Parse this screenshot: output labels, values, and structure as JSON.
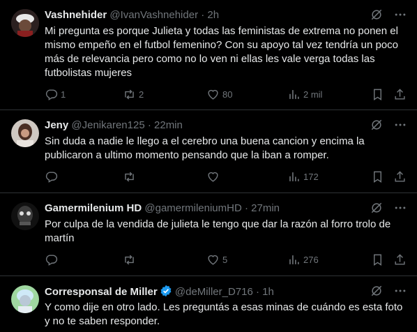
{
  "tweets": [
    {
      "name": "Vashnehider",
      "handle": "@IvanVashnehider",
      "time": "· 2h",
      "text": "Mi pregunta es porque Julieta y todas las feministas de extrema no ponen el mismo empeño en el futbol femenino? Con su apoyo tal vez tendría un poco más de relevancia pero como no lo ven ni ellas les vale verga todas las futbolistas mujeres",
      "replies": "1",
      "retweets": "2",
      "likes": "80",
      "views": "2 mil"
    },
    {
      "name": "Jeny",
      "handle": "@Jenikaren125",
      "time": "· 22min",
      "text": "Sin duda a nadie le llego a el cerebro una buena cancion y encima la publicaron a ultimo momento pensando que la iban a romper.",
      "replies": "",
      "retweets": "",
      "likes": "",
      "views": "172"
    },
    {
      "name": "Gamermilenium HD",
      "handle": "@gamermileniumHD",
      "time": "· 27min",
      "text": "Por culpa de la vendida de julieta le tengo que dar la razón al forro trolo de martín",
      "replies": "",
      "retweets": "",
      "likes": "5",
      "views": "276"
    },
    {
      "name": "Corresponsal de Miller",
      "handle": "@deMiller_D716",
      "time": "· 1h",
      "text": "Y como dije en otro lado. Les preguntás a esas minas de cuándo es esta foto y no te saben responder.",
      "replies": "",
      "retweets": "",
      "likes": "",
      "views": ""
    }
  ],
  "icons": {
    "reply": "reply-icon",
    "retweet": "retweet-icon",
    "like": "heart-icon",
    "views": "views-icon",
    "bookmark": "bookmark-icon",
    "share": "share-icon",
    "grok": "grok-icon",
    "more": "more-icon",
    "verified": "verified-badge-icon"
  },
  "colors": {
    "background": "#000000",
    "text": "#e7e9ea",
    "muted": "#71767b",
    "divider": "#2f3336",
    "verified": "#1d9bf0"
  }
}
